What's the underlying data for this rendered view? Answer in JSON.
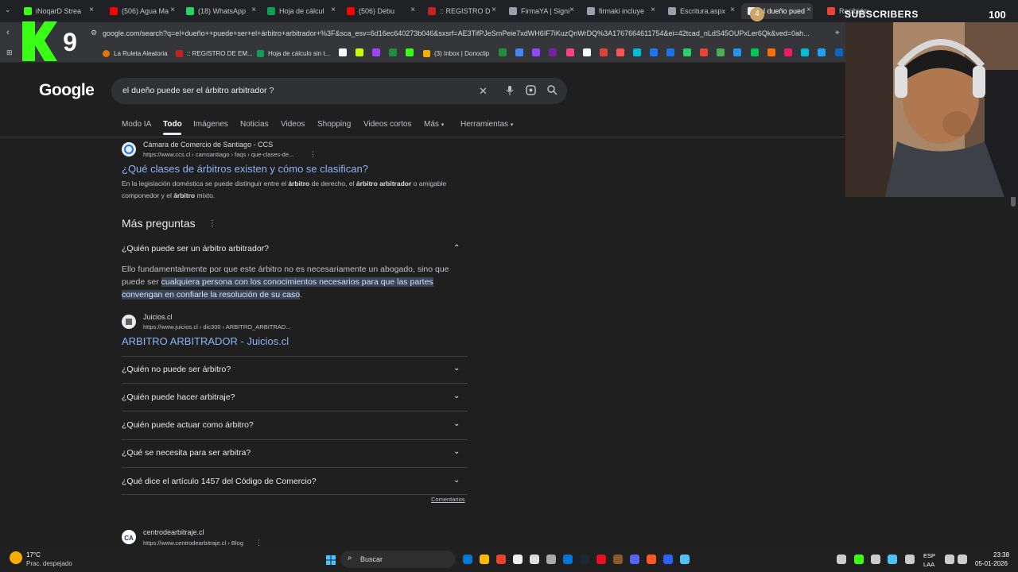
{
  "browser": {
    "tabs": [
      {
        "label": "iNoqarD Strea",
        "color": "#39ff14"
      },
      {
        "label": "(506) Agua Ma",
        "color": "#ff0000"
      },
      {
        "label": "(18) WhatsApp",
        "color": "#25d366"
      },
      {
        "label": "Hoja de cálcul",
        "color": "#0f9d58"
      },
      {
        "label": "(506) Debu",
        "color": "#ff0000"
      },
      {
        "label": ":: REGISTRO D",
        "color": "#c5221f"
      },
      {
        "label": "FirmaYA | Signi",
        "color": "#9aa0a6"
      },
      {
        "label": "firmaki incluye",
        "color": "#9aa0a6"
      },
      {
        "label": "Escritura.aspx",
        "color": "#9aa0a6"
      },
      {
        "label": "el dueño pued",
        "color": "#e8eaed"
      },
      {
        "label": "Recibidos (15)",
        "color": "#ea4335"
      }
    ],
    "active_tab_badge": "4",
    "url": "google.com/search?q=el+dueño++puede+ser+el+árbitro+arbitrador+%3F&sca_esv=6d16ec640273b046&sxsrf=AE3TifPJeSmPeie7xdWH6IF7iKuzQnWrDQ%3A1767664611754&ei=42tcad_nLdS45OUPxLer6Qk&ved=0ah...",
    "bookmarks": [
      {
        "label": "La Ruleta Aleatoria"
      },
      {
        "label": ":: REGISTRO DE EM..."
      },
      {
        "label": "Hoja de cálculo sin t..."
      },
      {
        "label": "(3) Inbox | Donoclip"
      }
    ]
  },
  "overlay": {
    "logo_text": "K 9",
    "subscribers_label": "SUBSCRIBERS",
    "subscribers_count": "100"
  },
  "google": {
    "logo": "Google",
    "query": "el dueño puede ser el árbitro arbitrador ?",
    "tabs": [
      "Modo IA",
      "Todo",
      "Imágenes",
      "Noticias",
      "Videos",
      "Shopping",
      "Videos cortos",
      "Más",
      "Herramientas"
    ],
    "result1": {
      "site": "Cámara de Comercio de Santiago - CCS",
      "cite": "https://www.ccs.cl › camsantiago › faqs › que-clases-de...",
      "title": "¿Qué clases de árbitros existen y cómo se clasifican?",
      "snippet_a": "En la legislación doméstica se puede distinguir entre el ",
      "snippet_b": "árbitro",
      "snippet_c": " de derecho, el ",
      "snippet_d": "árbitro arbitrador",
      "snippet_e": " o amigable componedor y el ",
      "snippet_f": "árbitro",
      "snippet_g": " mixto."
    },
    "paa_title": "Más preguntas",
    "paa_open": {
      "question": "¿Quién puede ser un árbitro arbitrador?",
      "answer_a": "Ello fundamentalmente por que este árbitro no es necesariamente un abogado, sino que puede ser ",
      "answer_mark": "cualquiera persona con los conocimientos necesarios para que las partes convengan en confiarle la resolución de su caso",
      "answer_end": ".",
      "source_site": "Juicios.cl",
      "source_cite": "https://www.juicios.cl › dic300 › ARBITRO_ARBITRAD...",
      "source_title": "ARBITRO ARBITRADOR - Juicios.cl"
    },
    "paa_questions": [
      "¿Quién no puede ser árbitro?",
      "¿Quién puede hacer arbitraje?",
      "¿Quién puede actuar como árbitro?",
      "¿Qué se necesita para ser arbitra?",
      "¿Qué dice el artículo 1457 del Código de Comercio?"
    ],
    "feedback": "Comentarios",
    "result2": {
      "site": "centrodearbitraje.cl",
      "cite": "https://www.centrodearbitraje.cl › Blog"
    }
  },
  "taskbar": {
    "weather_temp": "17°C",
    "weather_desc": "Prac. despejado",
    "search_label": "Buscar",
    "lang_top": "ESP",
    "lang_bottom": "LAA",
    "time": "23:38",
    "date": "05-01-2026"
  }
}
